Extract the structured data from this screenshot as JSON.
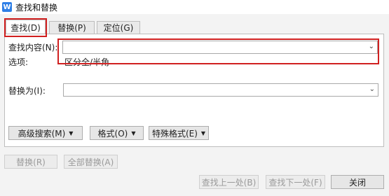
{
  "window": {
    "title": "查找和替换",
    "icon_letter": "W"
  },
  "tabs": [
    {
      "label": "查找(D)"
    },
    {
      "label": "替换(P)"
    },
    {
      "label": "定位(G)"
    }
  ],
  "find": {
    "label": "查找内容(N):",
    "value": "",
    "options_label": "选项:",
    "options_value": "区分全/半角"
  },
  "replace": {
    "label": "替换为(I):",
    "value": ""
  },
  "buttons": {
    "advanced_search": "高级搜索(M)",
    "format": "格式(O)",
    "special_format": "特殊格式(E)",
    "replace": "替换(R)",
    "replace_all": "全部替换(A)",
    "find_prev": "查找上一处(B)",
    "find_next": "查找下一处(F)",
    "close": "关闭"
  }
}
